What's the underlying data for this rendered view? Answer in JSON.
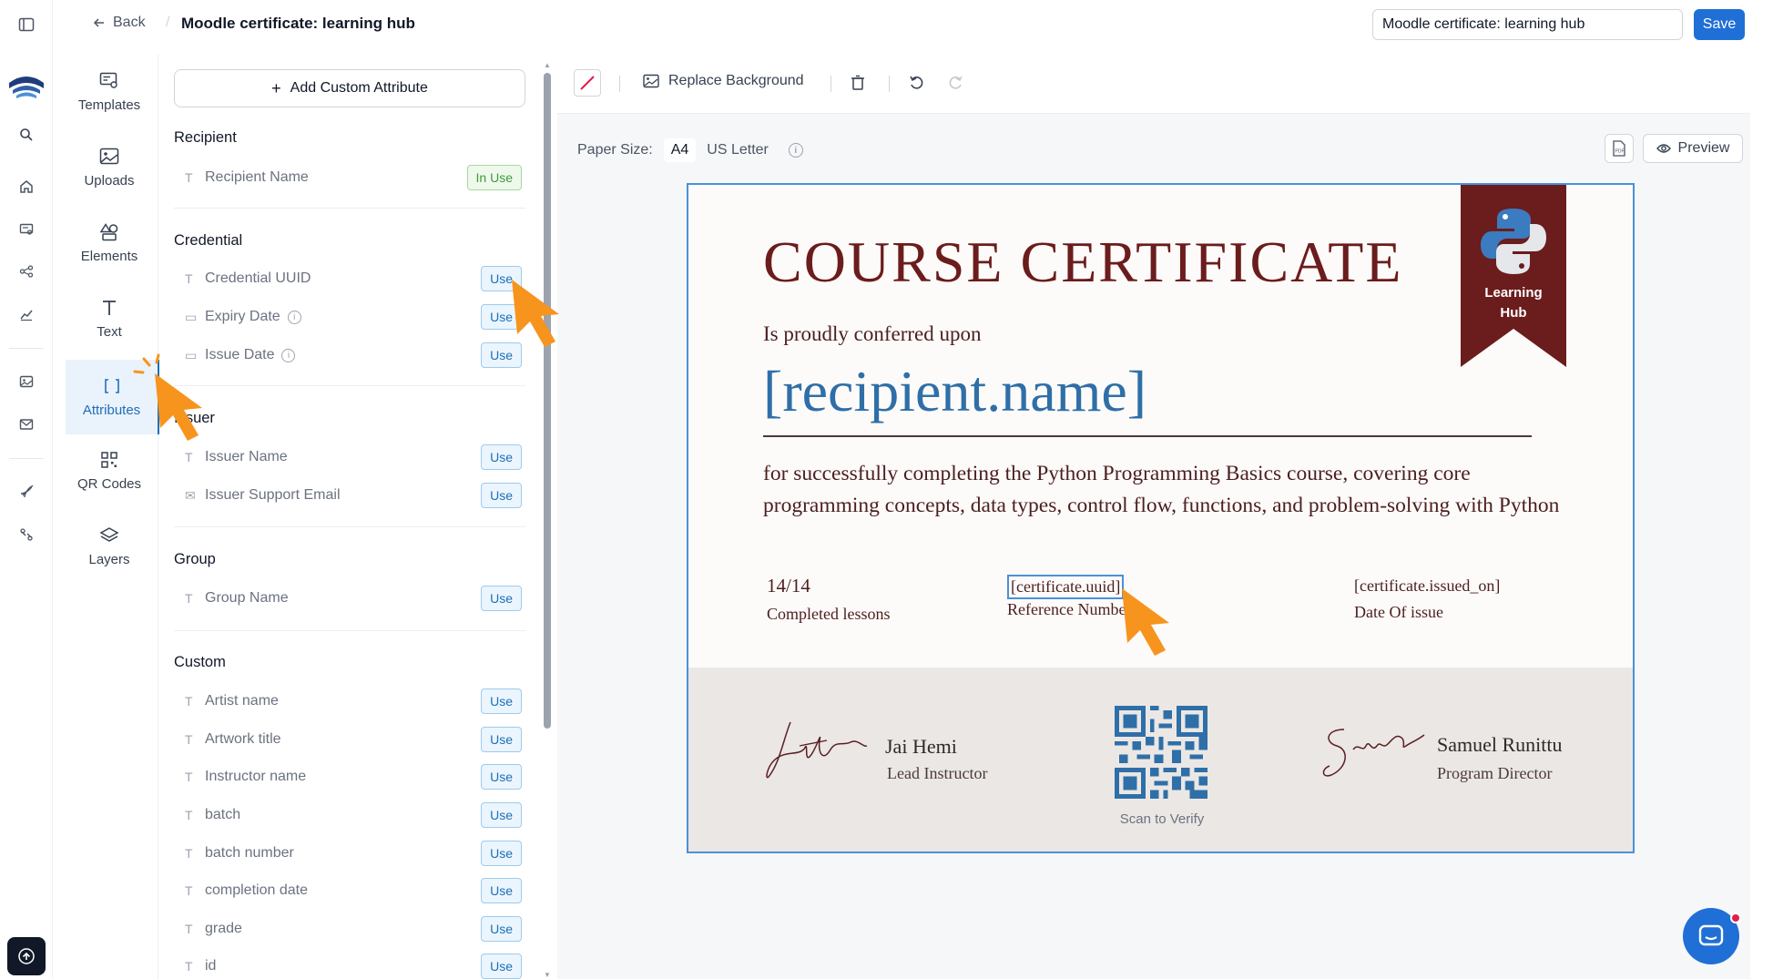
{
  "header": {
    "back_label": "Back",
    "breadcrumb_sep": "/",
    "title": "Moodle certificate: learning hub",
    "title_input_value": "Moodle certificate: learning hub",
    "save_label": "Save"
  },
  "tools": [
    {
      "label": "Templates",
      "icon": "templates-icon"
    },
    {
      "label": "Uploads",
      "icon": "image-icon"
    },
    {
      "label": "Elements",
      "icon": "shapes-icon"
    },
    {
      "label": "Text",
      "icon": "text-icon"
    },
    {
      "label": "Attributes",
      "icon": "brackets-icon"
    },
    {
      "label": "QR Codes",
      "icon": "qr-icon"
    },
    {
      "label": "Layers",
      "icon": "layers-icon"
    }
  ],
  "attributes": {
    "add_label": "Add Custom Attribute",
    "sections": {
      "recipient": {
        "title": "Recipient",
        "items": [
          {
            "label": "Recipient Name",
            "status": "In Use"
          }
        ]
      },
      "credential": {
        "title": "Credential",
        "items": [
          {
            "label": "Credential UUID",
            "status": "Use"
          },
          {
            "label": "Expiry Date",
            "status": "Use"
          },
          {
            "label": "Issue Date",
            "status": "Use"
          }
        ]
      },
      "issuer": {
        "title": "Issuer",
        "items": [
          {
            "label": "Issuer Name",
            "status": "Use"
          },
          {
            "label": "Issuer Support Email",
            "status": "Use"
          }
        ]
      },
      "group": {
        "title": "Group",
        "items": [
          {
            "label": "Group Name",
            "status": "Use"
          }
        ]
      },
      "custom": {
        "title": "Custom",
        "items": [
          {
            "label": "Artist name",
            "status": "Use"
          },
          {
            "label": "Artwork title",
            "status": "Use"
          },
          {
            "label": "Instructor name",
            "status": "Use"
          },
          {
            "label": "batch",
            "status": "Use"
          },
          {
            "label": "batch number",
            "status": "Use"
          },
          {
            "label": "completion date",
            "status": "Use"
          },
          {
            "label": "grade",
            "status": "Use"
          },
          {
            "label": "id",
            "status": "Use"
          }
        ]
      }
    }
  },
  "toolbar": {
    "replace_bg_label": "Replace Background",
    "paper_size_label": "Paper Size:",
    "paper_a4": "A4",
    "paper_us": "US Letter",
    "preview_label": "Preview",
    "pdf_label": "PDF"
  },
  "certificate": {
    "title": "COURSE CERTIFICATE",
    "conferred": "Is proudly conferred upon",
    "recipient": "[recipient.name]",
    "body": "for successfully completing the Python Programming Basics course, covering core programming concepts, data types, control flow, functions, and problem-solving with Python",
    "stat1_value": "14/14",
    "stat1_label": "Completed lessons",
    "stat2_value": "[certificate.uuid]",
    "stat2_label": "Reference Number",
    "stat3_value": "[certificate.issued_on]",
    "stat3_label": "Date Of issue",
    "badge_line1": "Learning",
    "badge_line2": "Hub",
    "sig1_name": "Jai Hemi",
    "sig1_role": "Lead Instructor",
    "sig2_name": "Samuel Runittu",
    "sig2_role": "Program Director",
    "scan_label": "Scan to Verify"
  },
  "colors": {
    "accent": "#1f6fb8",
    "cert_title": "#6b1c1c",
    "cert_recipient": "#2f6fa8",
    "ribbon": "#6b1c1c",
    "cursor": "#f7941d"
  }
}
